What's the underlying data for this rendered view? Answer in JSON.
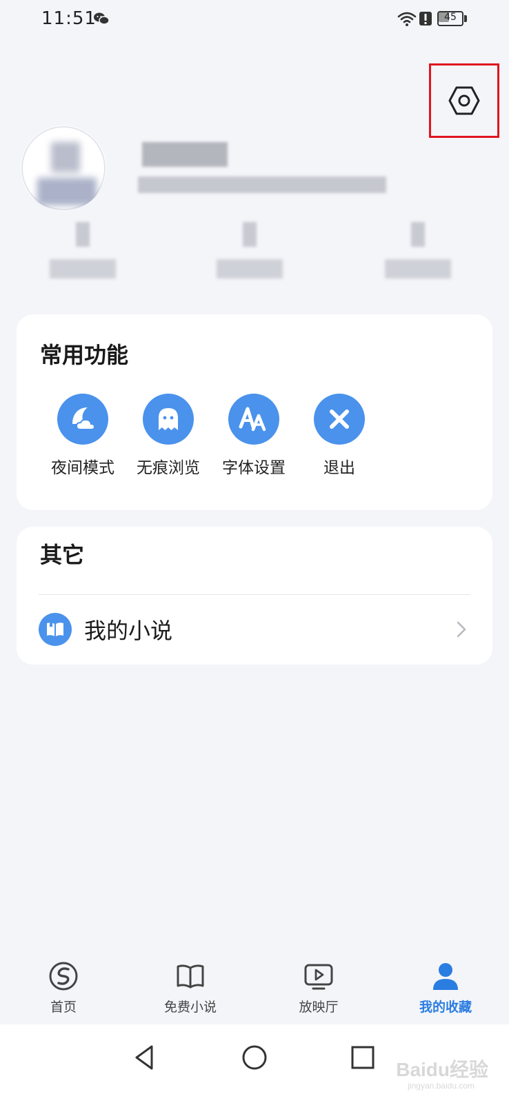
{
  "status_bar": {
    "time": "11:51",
    "battery_level": "45"
  },
  "header": {
    "settings_icon": "settings-hex-icon"
  },
  "profile": {
    "avatar_icon": "avatar-placeholder",
    "stats_count": 3
  },
  "common_functions": {
    "title": "常用功能",
    "items": [
      {
        "label": "夜间模式",
        "icon": "moon-cloud-icon"
      },
      {
        "label": "无痕浏览",
        "icon": "ghost-icon"
      },
      {
        "label": "字体设置",
        "icon": "font-aa-icon"
      },
      {
        "label": "退出",
        "icon": "close-x-icon"
      }
    ]
  },
  "other": {
    "title": "其它",
    "items": [
      {
        "label": "我的小说",
        "icon": "book-icon"
      }
    ]
  },
  "bottom_nav": {
    "items": [
      {
        "label": "首页",
        "icon": "s-logo-icon",
        "active": false
      },
      {
        "label": "免费小说",
        "icon": "open-book-icon",
        "active": false
      },
      {
        "label": "放映厅",
        "icon": "play-tv-icon",
        "active": false
      },
      {
        "label": "我的收藏",
        "icon": "user-icon",
        "active": true
      }
    ]
  },
  "system_nav": {
    "back_icon": "back-triangle-icon",
    "home_icon": "home-circle-icon",
    "recents_icon": "recents-square-icon"
  },
  "watermark": {
    "text": "Baidu经验",
    "sub": "jingyan.baidu.com"
  },
  "colors": {
    "accent": "#4a92ec",
    "nav_active": "#2a7de1",
    "highlight_box": "#e0141e",
    "background": "#f4f5f9"
  }
}
